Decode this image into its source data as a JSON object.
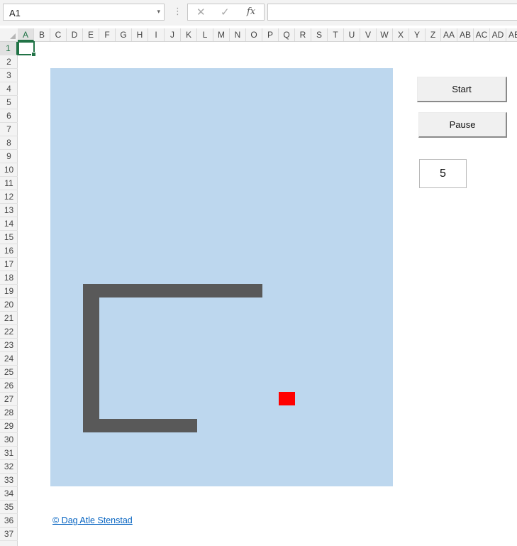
{
  "formula_bar": {
    "name_box": "A1",
    "name_box_caret": "▾",
    "separator_glyph": "⋮",
    "cancel_glyph": "✕",
    "enter_glyph": "✓",
    "fx_label": "fx",
    "formula_value": ""
  },
  "columns": [
    "A",
    "B",
    "C",
    "D",
    "E",
    "F",
    "G",
    "H",
    "I",
    "J",
    "K",
    "L",
    "M",
    "N",
    "O",
    "P",
    "Q",
    "R",
    "S",
    "T",
    "U",
    "V",
    "W",
    "X",
    "Y",
    "Z",
    "AA",
    "AB",
    "AC",
    "AD",
    "AE"
  ],
  "rows": [
    "1",
    "2",
    "3",
    "4",
    "5",
    "6",
    "7",
    "8",
    "9",
    "10",
    "11",
    "12",
    "13",
    "14",
    "15",
    "16",
    "17",
    "18",
    "19",
    "20",
    "21",
    "22",
    "23",
    "24",
    "25",
    "26",
    "27",
    "28",
    "29",
    "30",
    "31",
    "32",
    "33",
    "34",
    "35",
    "36",
    "37"
  ],
  "selected_cell": "A1",
  "game": {
    "board_color": "#bdd7ee",
    "snake_color": "#595959",
    "food_color": "#ff0000"
  },
  "controls": {
    "start_label": "Start",
    "pause_label": "Pause",
    "score": "5"
  },
  "credit": "© Dag Atle Stenstad",
  "colors": {
    "excel_green": "#217346",
    "link_blue": "#0563c1"
  }
}
